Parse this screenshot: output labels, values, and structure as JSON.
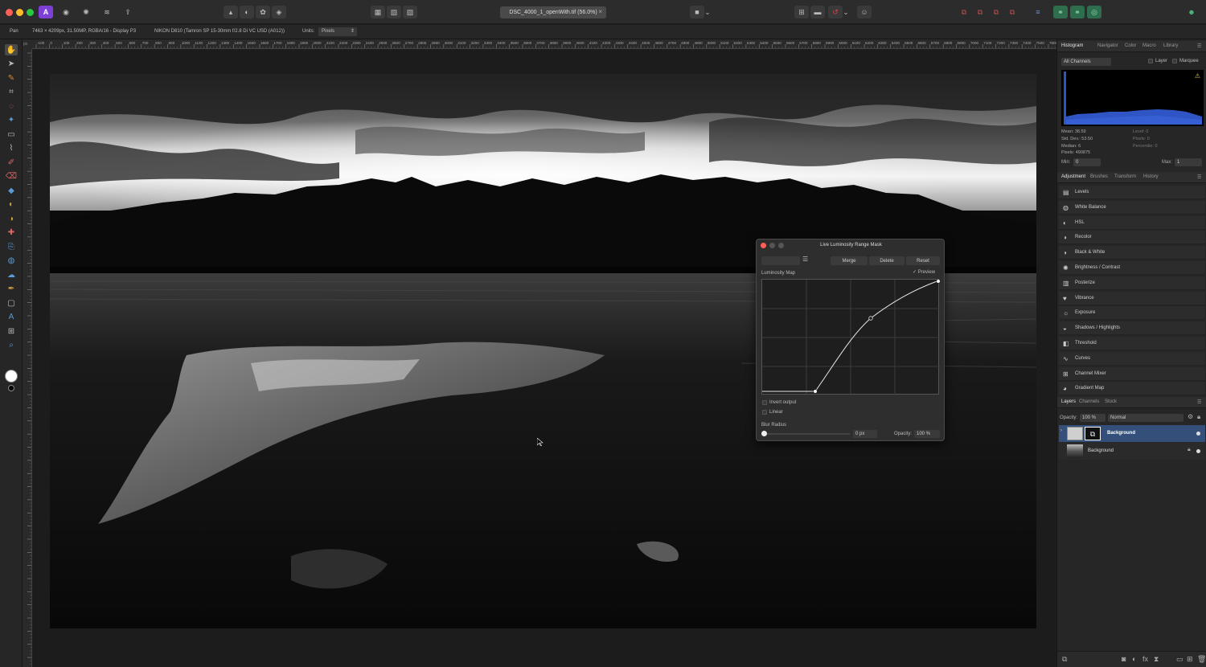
{
  "titlebar": {
    "document_tab": "DSC_4000_1_openWith.tif (56.0%)",
    "close_tab": "×"
  },
  "context": {
    "tool_name": "Pan",
    "doc_info": "7463 × 4209px, 31.50MP, RGBA/16 - Display P3",
    "camera_info": "NIKON D810 (Tamron SP 15-30mm f/2.8 Di VC USD (A012))",
    "units_label": "Units:",
    "units_value": "Pixels"
  },
  "ruler": {
    "corner": "px",
    "h_ticks": [
      "-100",
      "0",
      "100",
      "200",
      "300",
      "400",
      "500",
      "600",
      "700",
      "800",
      "900",
      "1000",
      "1100",
      "1200",
      "1300",
      "1400",
      "1500",
      "1600",
      "1700",
      "1800",
      "1900",
      "2000",
      "2100",
      "2200",
      "2300",
      "2400",
      "2500",
      "2600",
      "2700",
      "2800",
      "2900",
      "3000",
      "3100",
      "3200",
      "3300",
      "3400",
      "3500",
      "3600",
      "3700",
      "3800",
      "3900",
      "4000",
      "4100",
      "4200",
      "4300",
      "4400",
      "4500",
      "4600",
      "4700",
      "4800",
      "4900",
      "5000",
      "5100",
      "5200",
      "5300",
      "5400",
      "5500",
      "5600",
      "5700",
      "5800",
      "5900",
      "6000",
      "6100",
      "6200",
      "6300",
      "6400",
      "6500",
      "6600",
      "6700",
      "6800",
      "6900",
      "7000",
      "7100",
      "7200",
      "7300",
      "7400",
      "7500",
      "7600"
    ]
  },
  "histogram": {
    "tabs": [
      "Histogram",
      "Navigator",
      "Color",
      "Macro",
      "Library"
    ],
    "channel": "All Channels",
    "layer_label": "Layer",
    "marquee_label": "Marquee",
    "mean": "Mean: 38.59",
    "std_dev": "Std. Dev.: 53.50",
    "median": "Median: 6",
    "pixels": "Pixels: 490875",
    "level": "Level: 0",
    "pixels_r": "Pixels: 0",
    "percentile": "Percentile: 0",
    "min_label": "Min:",
    "min_value": "0",
    "max_label": "Max:",
    "max_value": "1"
  },
  "adjustment": {
    "tabs": [
      "Adjustment",
      "Brushes",
      "Transform",
      "History"
    ],
    "items": [
      "Levels",
      "White Balance",
      "HSL",
      "Recolor",
      "Black & White",
      "Brightness / Contrast",
      "Posterize",
      "Vibrance",
      "Exposure",
      "Shadows / Highlights",
      "Threshold",
      "Curves",
      "Channel Mixer",
      "Gradient Map"
    ]
  },
  "layers": {
    "tabs": [
      "Layers",
      "Channels",
      "Stock"
    ],
    "opacity_label": "Opacity:",
    "opacity_value": "100 %",
    "blend_mode": "Normal",
    "items": [
      "Background",
      "Background"
    ]
  },
  "dialog": {
    "title": "Live Luminosity Range Mask",
    "merge": "Merge",
    "delete": "Delete",
    "reset": "Reset",
    "map_label": "Luminosity Map",
    "preview": "Preview",
    "invert": "Invert output",
    "linear": "Linear",
    "blur_label": "Blur Radius",
    "blur_value": "0 px",
    "opacity_label": "Opacity:",
    "opacity_value": "100 %"
  },
  "colors": {
    "accent": "#3d5a80",
    "histogram_fill": "#2f55c4",
    "close_red": "#ff5f57",
    "min_yellow": "#febc2e",
    "max_green": "#28c840",
    "app_icon": "#7d3fd6"
  }
}
